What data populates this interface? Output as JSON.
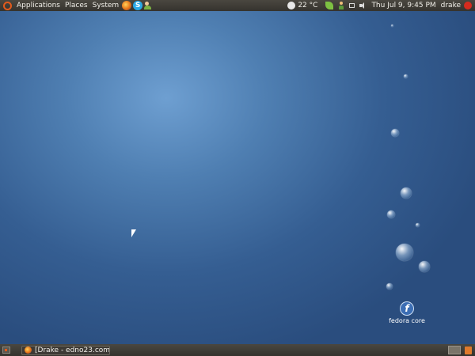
{
  "top_panel": {
    "menus": [
      "Applications",
      "Places",
      "System"
    ],
    "launchers": [
      "firefox-icon",
      "skype-icon",
      "users-icon"
    ],
    "weather": "22 °C",
    "clock": "Thu Jul  9,  9:45 PM",
    "user": "drake"
  },
  "desktop": {
    "icons": [
      {
        "label": "fedora core",
        "icon": "fedora-icon"
      }
    ]
  },
  "bottom_panel": {
    "task_title": "[Drake - edno23.com -..."
  }
}
